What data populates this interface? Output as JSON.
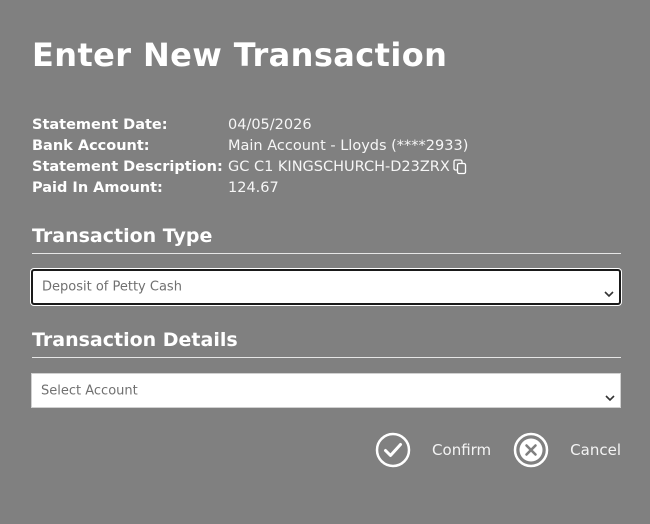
{
  "dialog": {
    "title": "Enter New Transaction"
  },
  "statement": {
    "rows": [
      {
        "label": "Statement Date:",
        "value": "04/05/2026"
      },
      {
        "label": "Bank Account:",
        "value": "Main Account - Lloyds (****2933)"
      },
      {
        "label": "Statement Description:",
        "value": "GC C1 KINGSCHURCH-D23ZRX"
      },
      {
        "label": "Paid In Amount:",
        "value": "124.67"
      }
    ]
  },
  "transaction_type": {
    "heading": "Transaction Type",
    "selected": "Deposit of Petty Cash"
  },
  "transaction_details": {
    "heading": "Transaction Details",
    "account_placeholder": "Select Account"
  },
  "actions": {
    "confirm_label": "Confirm",
    "cancel_label": "Cancel"
  },
  "icons": {
    "copy": "copy-icon",
    "chevron": "chevron-down-icon",
    "confirm": "check-circle-icon",
    "cancel": "x-circle-icon"
  },
  "colors": {
    "background": "#808080",
    "text": "#ffffff",
    "field_background": "#ffffff",
    "field_text": "#707070"
  }
}
